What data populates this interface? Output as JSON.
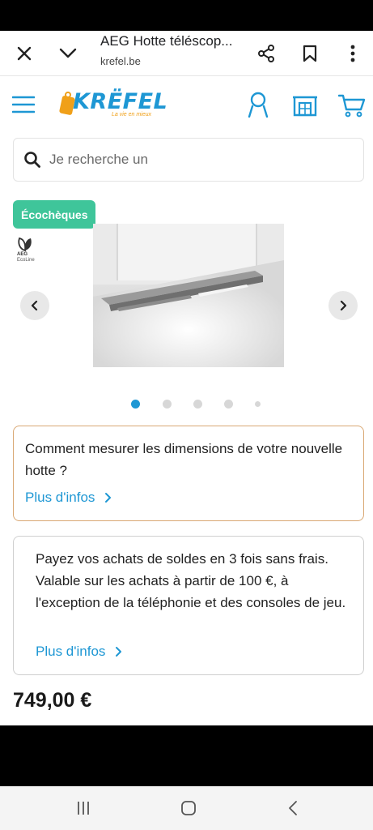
{
  "browser": {
    "page_title": "AEG Hotte téléscop...",
    "url": "krefel.be"
  },
  "site": {
    "logo_text": "KRËFEL",
    "logo_tagline": "La vie en mieux",
    "brand_color": "#1e97d4",
    "accent_color": "#f0a019"
  },
  "search": {
    "placeholder": "Je recherche un"
  },
  "product": {
    "badge": "Écochèques",
    "ecoline_brand": "AEG",
    "ecoline_label": "EcoLine",
    "carousel_total_dots": 5,
    "carousel_active_index": 0,
    "price": "749,00 €"
  },
  "info_card": {
    "text": "Comment mesurer les dimensions de votre nouvelle hotte ?",
    "link": "Plus d'infos"
  },
  "pay_card": {
    "text": "Payez vos achats de soldes en 3 fois sans frais. Valable sur les achats à partir de 100 €, à l'exception de la téléphonie et des consoles de jeu.",
    "link": "Plus d'infos"
  },
  "icons": {
    "browser": [
      "close-icon",
      "chevron-down-icon",
      "share-icon",
      "bookmark-icon",
      "more-vert-icon"
    ],
    "header": [
      "menu-icon",
      "user-icon",
      "store-icon",
      "cart-icon"
    ],
    "system_nav": [
      "recent-apps-icon",
      "home-icon",
      "back-icon"
    ]
  }
}
